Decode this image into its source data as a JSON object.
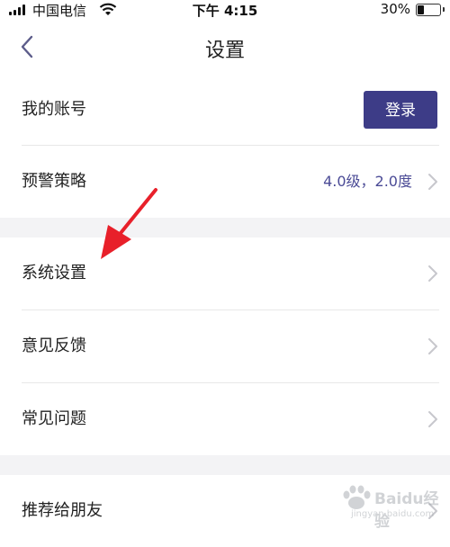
{
  "status_bar": {
    "carrier": "中国电信",
    "time": "下午 4:15",
    "battery_pct": "30%",
    "battery_level": 0.3
  },
  "nav": {
    "title": "设置",
    "back_icon": "chevron-left-icon"
  },
  "sections": [
    {
      "rows": [
        {
          "label": "我的账号",
          "button_label": "登录"
        },
        {
          "label": "预警策略",
          "value": "4.0级，2.0度"
        }
      ]
    },
    {
      "rows": [
        {
          "label": "系统设置"
        },
        {
          "label": "意见反馈"
        },
        {
          "label": "常见问题"
        }
      ]
    },
    {
      "rows": [
        {
          "label": "推荐给朋友"
        }
      ]
    }
  ],
  "colors": {
    "accent": "#3d3c87",
    "value_text": "#4b4b96",
    "annotation_arrow": "#e8202a",
    "section_gap": "#f3f3f5"
  },
  "watermark": {
    "text": "Baidu经验",
    "url": "jingyan.baidu.com"
  }
}
